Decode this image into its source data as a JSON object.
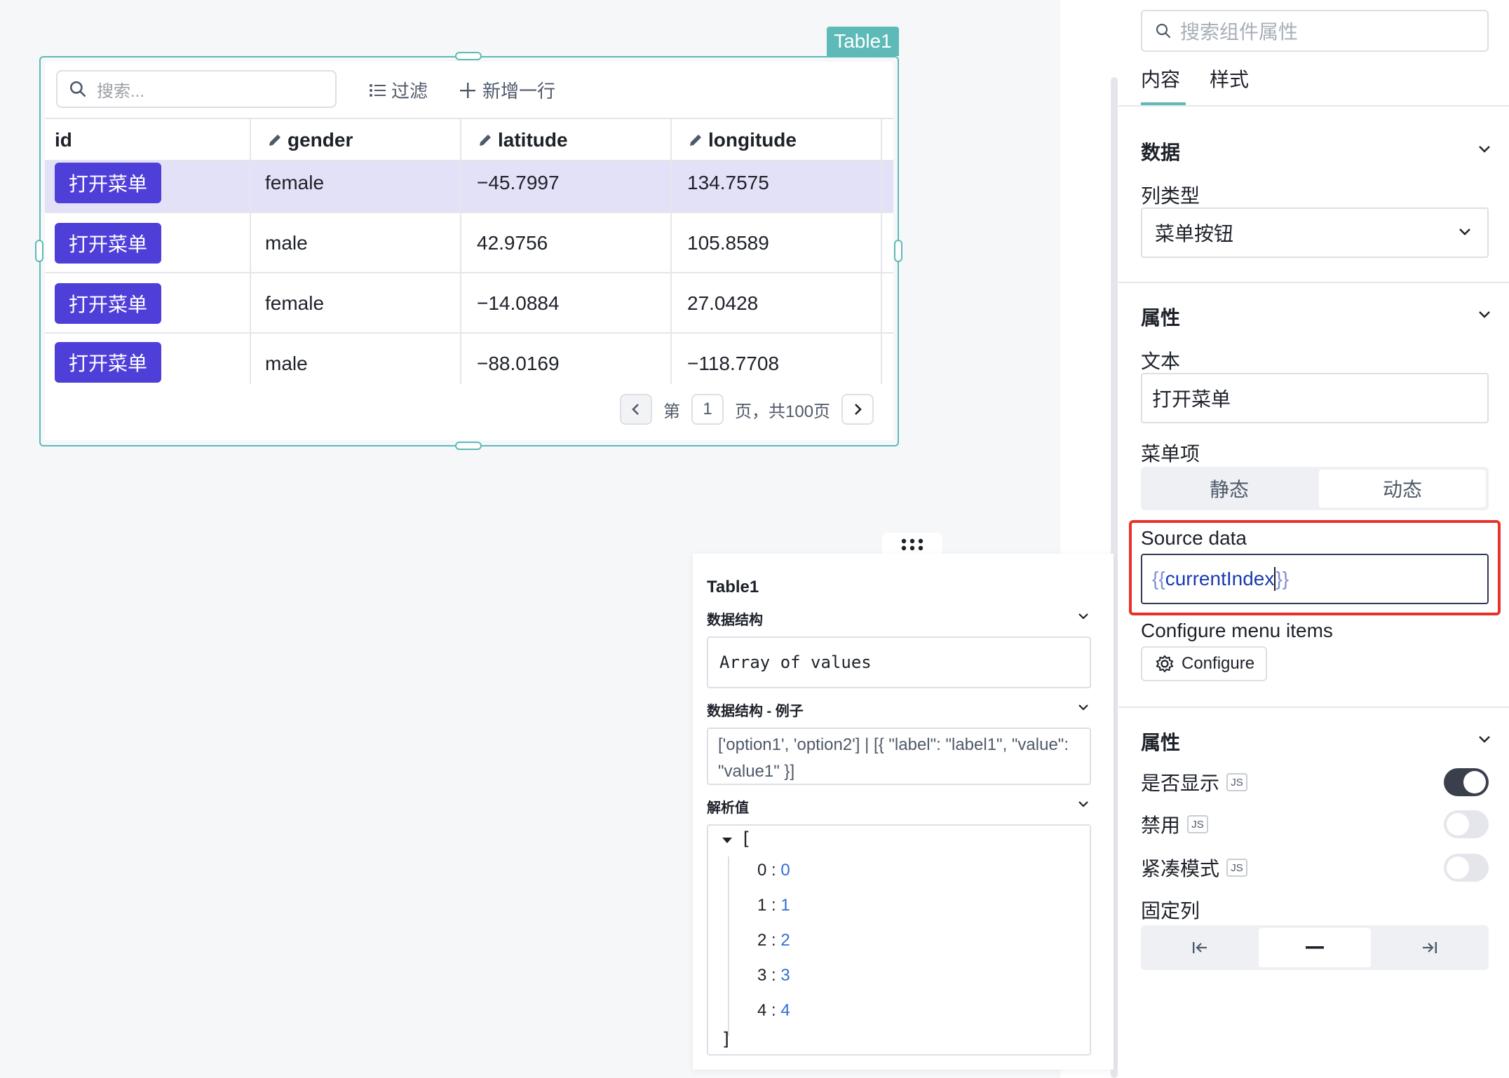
{
  "table_widget": {
    "tag_label": "Table1",
    "search_placeholder": "搜索...",
    "filter_label": "过滤",
    "add_row_label": "新增一行",
    "columns": [
      "id",
      "gender",
      "latitude",
      "longitude"
    ],
    "rows": [
      {
        "button": "打开菜单",
        "gender": "female",
        "latitude": "−45.7997",
        "longitude": "134.7575"
      },
      {
        "button": "打开菜单",
        "gender": "male",
        "latitude": "42.9756",
        "longitude": "105.8589"
      },
      {
        "button": "打开菜单",
        "gender": "female",
        "latitude": "−14.0884",
        "longitude": "27.0428"
      },
      {
        "button": "打开菜单",
        "gender": "male",
        "latitude": "−88.0169",
        "longitude": "−118.7708"
      }
    ],
    "pager": {
      "prefix": "第",
      "page": "1",
      "suffix": "页，共100页"
    }
  },
  "float_panel": {
    "title": "Table1",
    "data_structure_label": "数据结构",
    "data_structure_value": "Array of values",
    "example_label": "数据结构 - 例子",
    "example_value": "['option1', 'option2'] | [{ \"label\": \"label1\", \"value\": \"value1\" }]",
    "parsed_label": "解析值",
    "parsed_open": "[",
    "parsed_close": "]",
    "parsed_items": [
      {
        "key": "0",
        "value": "0"
      },
      {
        "key": "1",
        "value": "1"
      },
      {
        "key": "2",
        "value": "2"
      },
      {
        "key": "3",
        "value": "3"
      },
      {
        "key": "4",
        "value": "4"
      }
    ]
  },
  "props_panel": {
    "search_placeholder": "搜索组件属性",
    "tabs": [
      "内容",
      "样式"
    ],
    "active_tab": "内容",
    "section_data": "数据",
    "column_type_label": "列类型",
    "column_type_value": "菜单按钮",
    "section_props": "属性",
    "text_label": "文本",
    "text_value": "打开菜单",
    "menu_items_label": "菜单项",
    "menu_mode_static": "静态",
    "menu_mode_dynamic": "动态",
    "active_menu_mode": "动态",
    "source_data_label": "Source data",
    "source_data_open": "{{",
    "source_data_value": "currentIndex",
    "source_data_close": "}}",
    "configure_menu_label": "Configure menu items",
    "configure_button": "Configure",
    "section_attrs": "属性",
    "visible_label": "是否显示",
    "visible_on": true,
    "disabled_label": "禁用",
    "disabled_on": false,
    "compact_label": "紧凑模式",
    "compact_on": false,
    "js_badge": "JS",
    "fixed_column_label": "固定列",
    "fixed_column_active": "none"
  },
  "colors": {
    "accent": "#5ebab7",
    "menu_button": "#4f3fd9",
    "selected_row": "#e3e1f8",
    "highlight": "#e5332a",
    "value_blue": "#2f6fd6"
  }
}
